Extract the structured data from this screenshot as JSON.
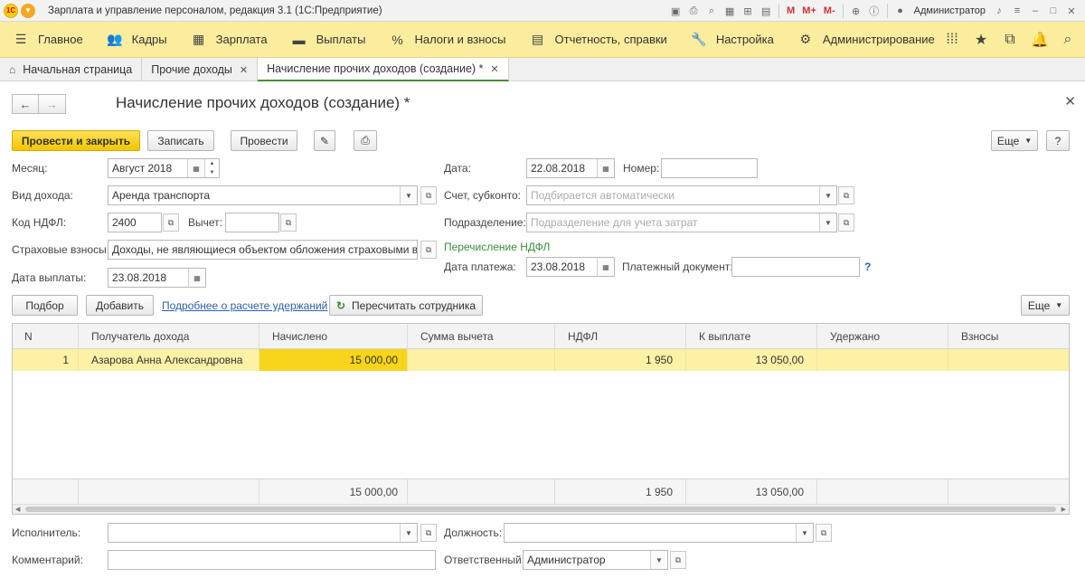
{
  "app": {
    "title": "Зарплата и управление персоналом, редакция 3.1  (1С:Предприятие)",
    "logo": "1С",
    "user": "Администратор",
    "toolbar_icons": [
      "save-icon",
      "print-icon",
      "find-icon",
      "calc-icon",
      "attach-icon",
      "calendar-icon"
    ],
    "m_labels": [
      "M",
      "M+",
      "M-"
    ]
  },
  "mainmenu": [
    {
      "label": "Главное",
      "icon": "menu-icon"
    },
    {
      "label": "Кадры",
      "icon": "people-icon"
    },
    {
      "label": "Зарплата",
      "icon": "calculator-icon"
    },
    {
      "label": "Выплаты",
      "icon": "wallet-icon"
    },
    {
      "label": "Налоги и взносы",
      "icon": "percent-icon"
    },
    {
      "label": "Отчетность, справки",
      "icon": "document-icon"
    },
    {
      "label": "Настройка",
      "icon": "wrench-icon"
    },
    {
      "label": "Администрирование",
      "icon": "gear-icon"
    }
  ],
  "tabs": [
    {
      "label": "Начальная страница"
    },
    {
      "label": "Прочие доходы"
    },
    {
      "label": "Начисление прочих доходов (создание) *"
    }
  ],
  "form": {
    "title": "Начисление прочих доходов (создание) *",
    "buttons": {
      "post_close": "Провести и закрыть",
      "save": "Записать",
      "post": "Провести",
      "more": "Еще",
      "help": "?"
    },
    "labels": {
      "month": "Месяц:",
      "income_type": "Вид дохода:",
      "ndfl_code": "Код НДФЛ:",
      "deduction": "Вычет:",
      "insurance": "Страховые взносы:",
      "payment_date": "Дата выплаты:",
      "date": "Дата:",
      "number": "Номер:",
      "account": "Счет, субконто:",
      "department": "Подразделение:",
      "ndfl_transfer": "Перечисление НДФЛ",
      "pay_date": "Дата платежа:",
      "pay_doc": "Платежный документ:"
    },
    "values": {
      "month": "Август 2018",
      "income_type": "Аренда транспорта",
      "ndfl_code": "2400",
      "deduction": "",
      "insurance": "Доходы, не являющиеся объектом обложения страховыми взно",
      "payment_date": "23.08.2018",
      "date": "22.08.2018",
      "number": "",
      "account_placeholder": "Подбирается автоматически",
      "department_placeholder": "Подразделение для учета затрат",
      "pay_date": "23.08.2018",
      "pay_doc": ""
    }
  },
  "table_toolbar": {
    "pick": "Подбор",
    "add": "Добавить",
    "details_link": "Подробнее о расчете удержаний",
    "recalc": "Пересчитать сотрудника",
    "more": "Еще"
  },
  "table": {
    "columns": [
      "N",
      "Получатель дохода",
      "Начислено",
      "Сумма вычета",
      "НДФЛ",
      "К выплате",
      "Удержано",
      "Взносы"
    ],
    "rows": [
      {
        "n": "1",
        "recipient": "Азарова Анна Александровна",
        "accrued": "15 000,00",
        "deduction": "",
        "ndfl": "1 950",
        "payout": "13 050,00",
        "withheld": "",
        "contrib": ""
      }
    ],
    "totals": {
      "accrued": "15 000,00",
      "ndfl": "1 950",
      "payout": "13 050,00"
    }
  },
  "footer": {
    "labels": {
      "executor": "Исполнитель:",
      "position": "Должность:",
      "comment": "Комментарий:",
      "responsible": "Ответственный:"
    },
    "values": {
      "executor": "",
      "position": "",
      "comment": "",
      "responsible": "Администратор"
    }
  },
  "colors": {
    "menu_bg": "#fbed9e",
    "primary_button": "#f5c600",
    "selected_row": "#fdf1a6",
    "highlight_cell": "#f8d41c",
    "link": "#2c5fa8",
    "green_label": "#3a8c3a"
  }
}
